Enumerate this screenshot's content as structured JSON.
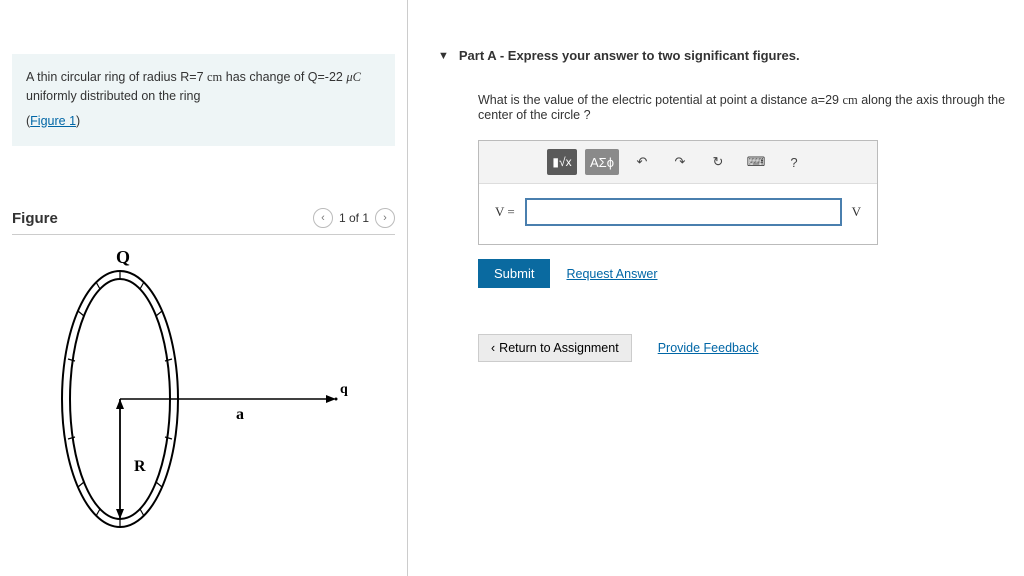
{
  "problem": {
    "text_prefix": "A thin circular ring of radius R=7 ",
    "unit_cm": "cm",
    "text_mid": " has change of Q=-22 ",
    "unit_uc": "μC",
    "text_suffix": "   uniformly distributed on the ring",
    "figure_link": "Figure 1"
  },
  "figure": {
    "title": "Figure",
    "pager": "1 of 1",
    "labels": {
      "Q": "Q",
      "R": "R",
      "a": "a",
      "q": "q"
    }
  },
  "part": {
    "header": "Part A - Express your answer to two significant figures.",
    "question_prefix": "What is the value of the electric potential at point a distance a=29 ",
    "question_unit": "cm",
    "question_suffix": " along the axis through the center of the circle ?"
  },
  "toolbar": {
    "templates_label": "▮√x",
    "greek_label": "ΑΣϕ",
    "undo": "↶",
    "redo": "↷",
    "reset": "↻",
    "keyboard": "⌨",
    "help": "?"
  },
  "answer": {
    "var_label": "V =",
    "unit_label": "V",
    "value": ""
  },
  "actions": {
    "submit": "Submit",
    "request_answer": "Request Answer",
    "return": "Return to Assignment",
    "feedback": "Provide Feedback"
  }
}
